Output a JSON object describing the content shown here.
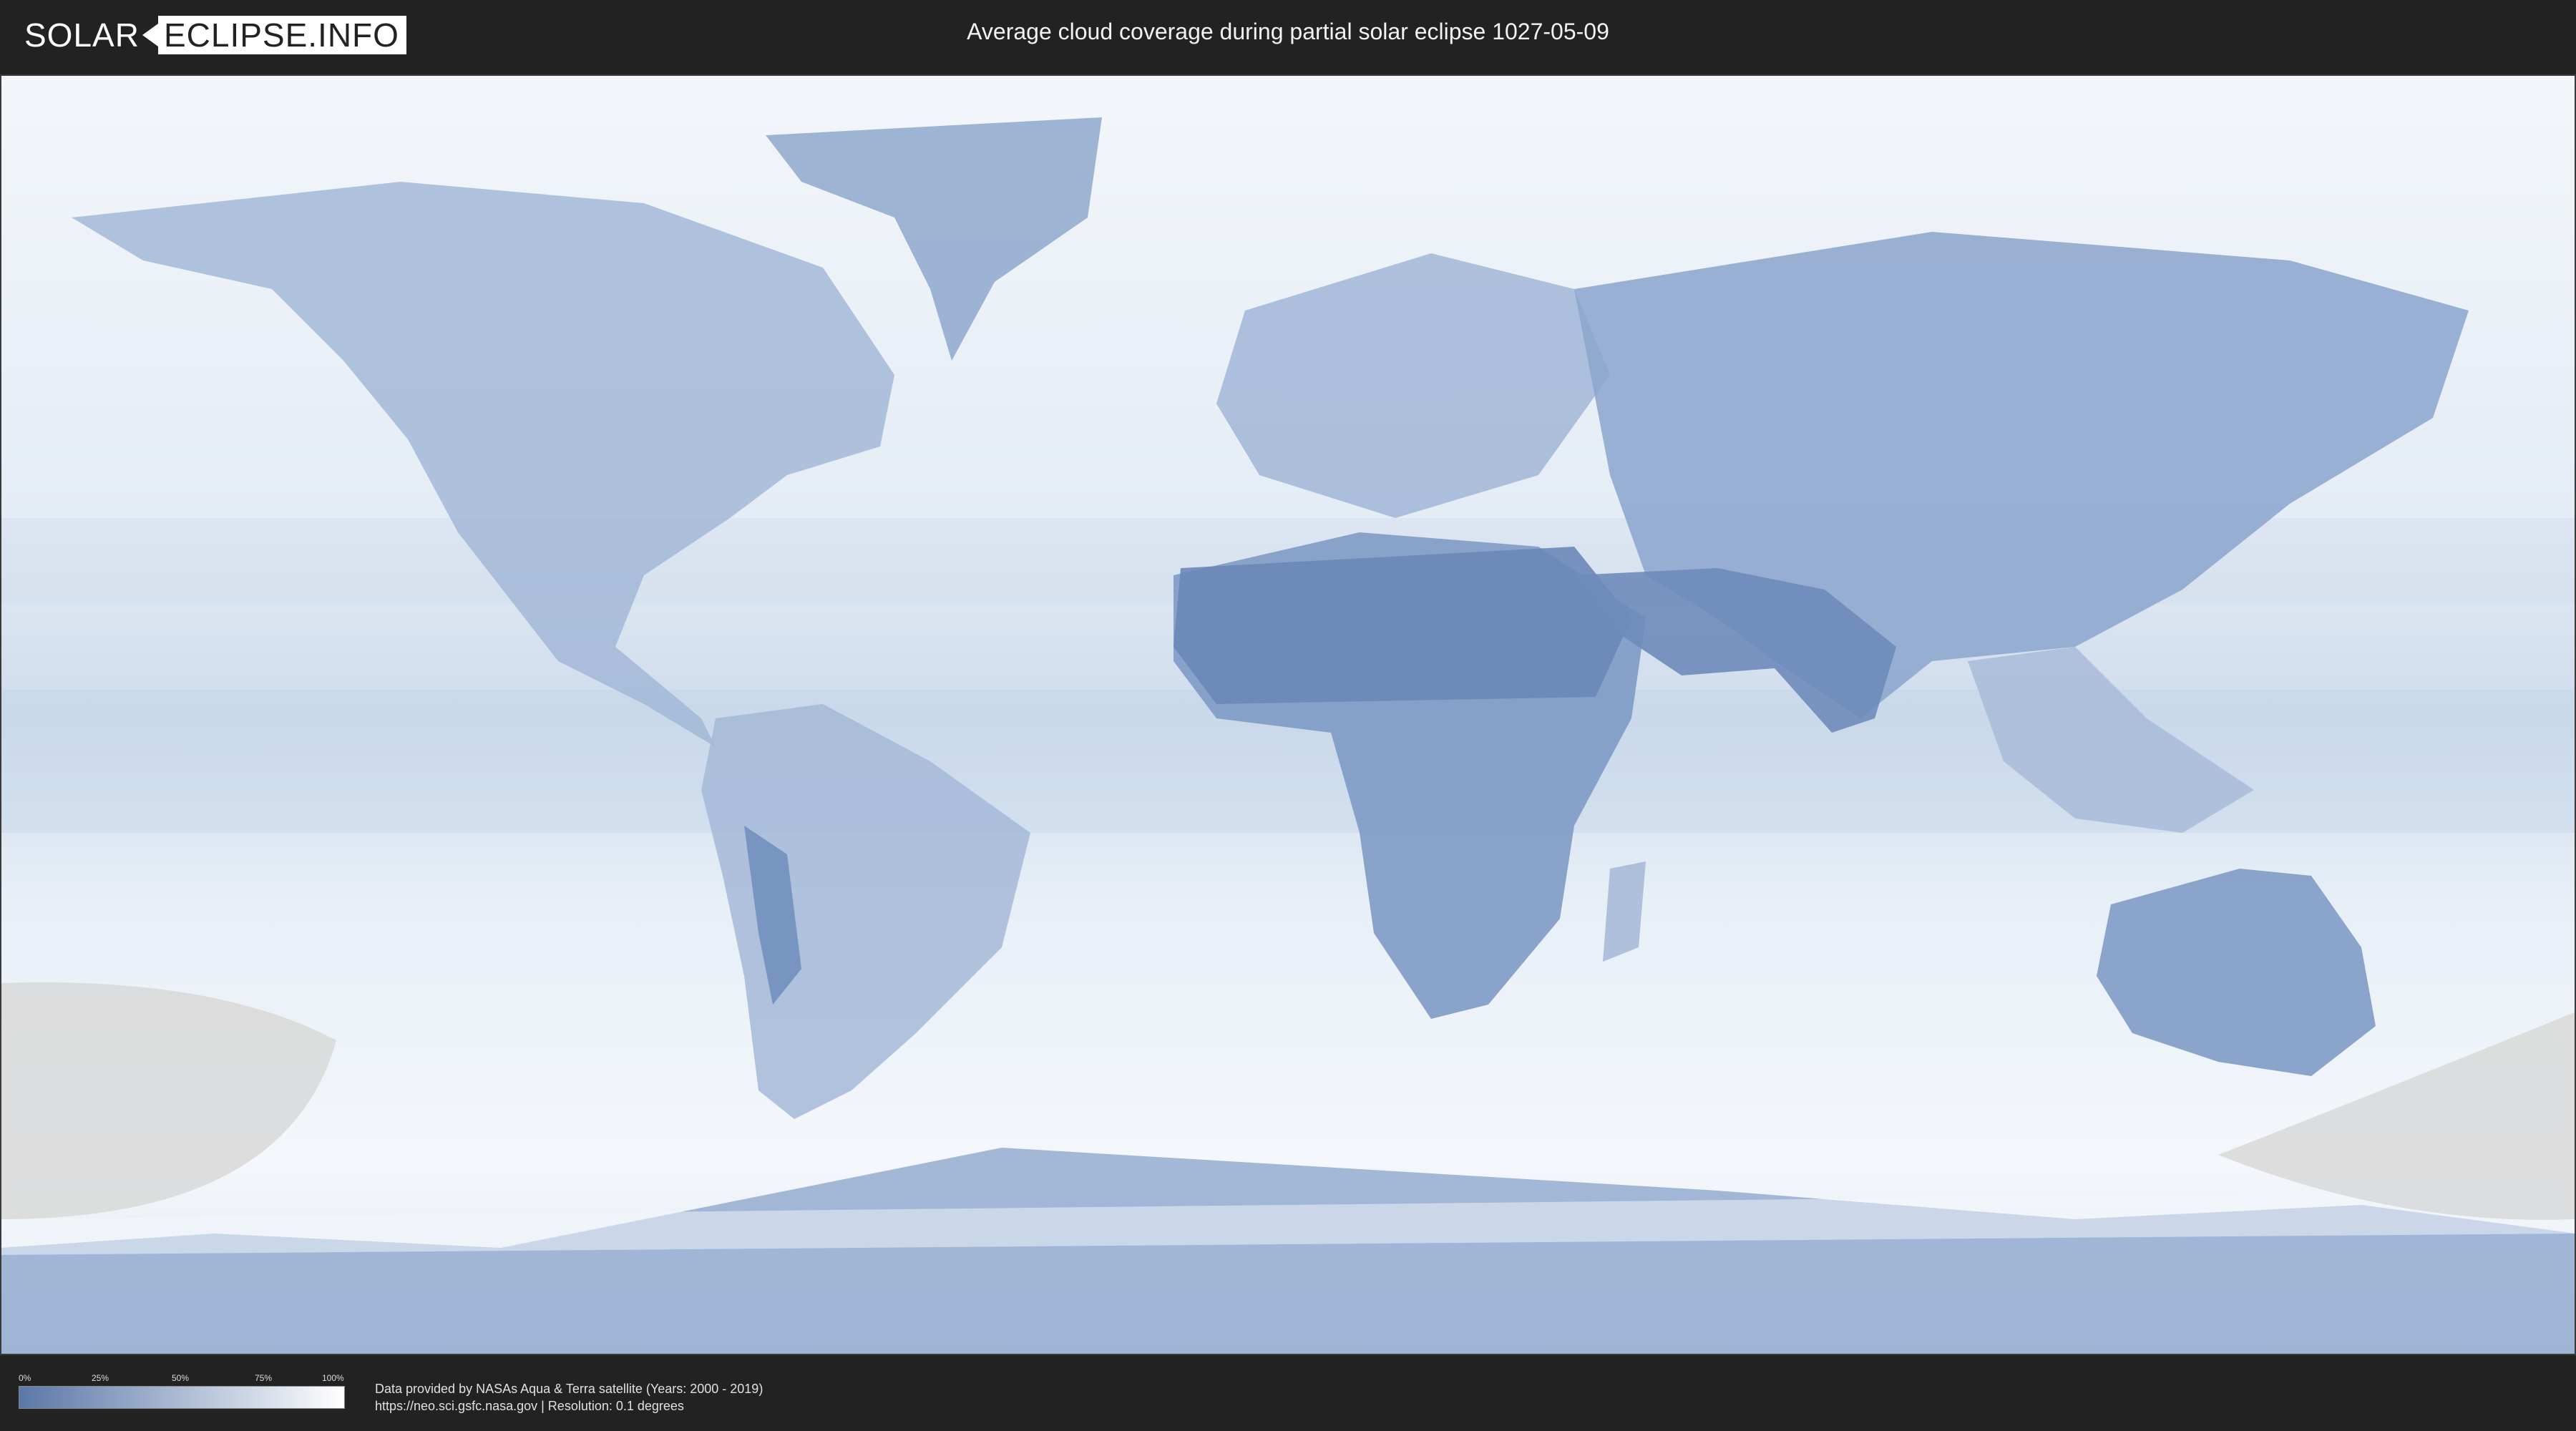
{
  "header": {
    "logo_left": "SOLAR",
    "logo_right": "ECLIPSE.INFO",
    "title": "Average cloud coverage during partial solar eclipse 1027-05-09"
  },
  "map": {
    "ocean_color": "#e6eef7",
    "land_color": "#7f9cc6",
    "shadow_color": "#d8d8d8"
  },
  "legend": {
    "ticks": [
      "0%",
      "25%",
      "50%",
      "75%",
      "100%"
    ],
    "gradient_from": "#5b78a8",
    "gradient_to": "#ffffff"
  },
  "footer": {
    "credit_line": "Data provided by NASAs Aqua & Terra satellite (Years: 2000 - 2019)",
    "source_line": "https://neo.sci.gsfc.nasa.gov | Resolution: 0.1 degrees"
  }
}
